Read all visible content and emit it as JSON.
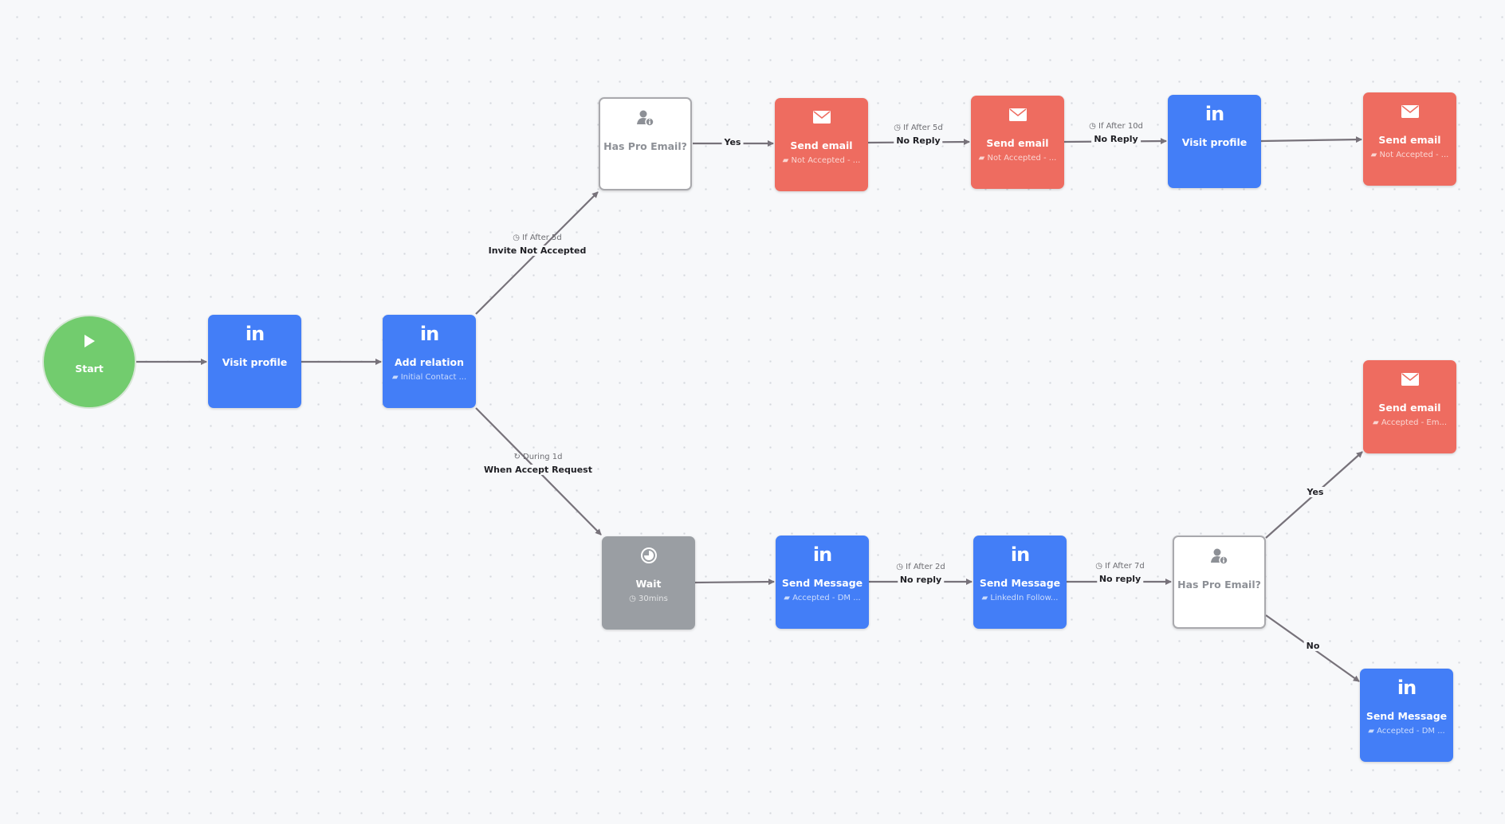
{
  "colors": {
    "linkedin": "#437ef7",
    "email": "#ee6c60",
    "wait": "#9a9ea3",
    "start": "#72cc6e",
    "condition": "#ffffff",
    "edge": "#77727a"
  },
  "nodes": {
    "start": {
      "title": "Start",
      "icon": "play-icon"
    },
    "visit_profile_1": {
      "title": "Visit profile",
      "icon": "linkedin-icon",
      "icon_text": "in"
    },
    "add_relation": {
      "title": "Add relation",
      "subtitle": "Initial Contact ...",
      "icon": "linkedin-icon",
      "icon_text": "in"
    },
    "has_pro_email_1": {
      "title": "Has Pro Email?",
      "icon": "person-info-icon"
    },
    "send_email_1": {
      "title": "Send email",
      "subtitle": "Not Accepted - ...",
      "icon": "envelope-icon"
    },
    "send_email_2": {
      "title": "Send email",
      "subtitle": "Not Accepted - ...",
      "icon": "envelope-icon"
    },
    "visit_profile_2": {
      "title": "Visit profile",
      "icon": "linkedin-icon",
      "icon_text": "in"
    },
    "send_email_3": {
      "title": "Send email",
      "subtitle": "Not Accepted - ...",
      "icon": "envelope-icon"
    },
    "wait": {
      "title": "Wait",
      "subtitle": "30mins",
      "icon": "clock-icon"
    },
    "send_message_1": {
      "title": "Send Message",
      "subtitle": "Accepted - DM ...",
      "icon": "linkedin-icon",
      "icon_text": "in"
    },
    "send_message_2": {
      "title": "Send Message",
      "subtitle": "LinkedIn Follow...",
      "icon": "linkedin-icon",
      "icon_text": "in"
    },
    "has_pro_email_2": {
      "title": "Has Pro Email?",
      "icon": "person-info-icon"
    },
    "send_email_accepted": {
      "title": "Send email",
      "subtitle": "Accepted - Em...",
      "icon": "envelope-icon"
    },
    "send_message_3": {
      "title": "Send Message",
      "subtitle": "Accepted - DM ...",
      "icon": "linkedin-icon",
      "icon_text": "in"
    }
  },
  "edges": {
    "invite_not_accepted": {
      "condition": "If After 5d",
      "label": "Invite Not Accepted"
    },
    "accept_request": {
      "condition": "During 1d",
      "label": "When Accept Request"
    },
    "yes_1": {
      "label": "Yes"
    },
    "no_reply_5d": {
      "condition": "If After 5d",
      "label": "No Reply"
    },
    "no_reply_10d": {
      "condition": "If After 10d",
      "label": "No Reply"
    },
    "no_reply_2d": {
      "condition": "If After 2d",
      "label": "No reply"
    },
    "no_reply_7d": {
      "condition": "If After 7d",
      "label": "No reply"
    },
    "yes_2": {
      "label": "Yes"
    },
    "no_2": {
      "label": "No"
    }
  }
}
